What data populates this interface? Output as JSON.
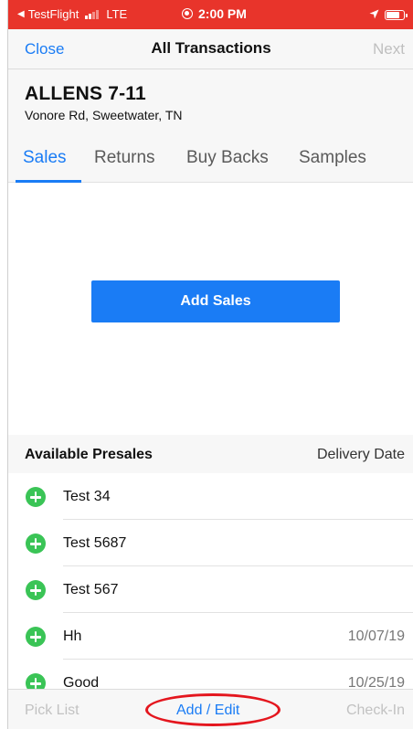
{
  "status_bar": {
    "carrier": "TestFlight",
    "network": "LTE",
    "time": "2:00 PM",
    "back_icon": "back-triangle-icon",
    "location_icon": "location-arrow-icon",
    "background_color": "#e8342b"
  },
  "nav": {
    "close_label": "Close",
    "title": "All Transactions",
    "next_label": "Next"
  },
  "store": {
    "name": "ALLENS 7-11",
    "address": "Vonore Rd, Sweetwater, TN"
  },
  "tabs": [
    {
      "label": "Sales",
      "active": true
    },
    {
      "label": "Returns",
      "active": false
    },
    {
      "label": "Buy Backs",
      "active": false
    },
    {
      "label": "Samples",
      "active": false
    }
  ],
  "add_sales_label": "Add Sales",
  "presales": {
    "header_left": "Available Presales",
    "header_right": "Delivery Date",
    "items": [
      {
        "label": "Test 34",
        "date": ""
      },
      {
        "label": "Test 5687",
        "date": ""
      },
      {
        "label": "Test 567",
        "date": ""
      },
      {
        "label": "Hh",
        "date": "10/07/19"
      },
      {
        "label": "Good",
        "date": "10/25/19"
      }
    ]
  },
  "toolbar": {
    "pick_list_label": "Pick List",
    "add_edit_label": "Add / Edit",
    "check_in_label": "Check-In"
  },
  "colors": {
    "accent": "#1a7cf5",
    "add_icon": "#3ac456",
    "highlight_circle": "#e4161e",
    "disabled": "#c2c2c2"
  }
}
